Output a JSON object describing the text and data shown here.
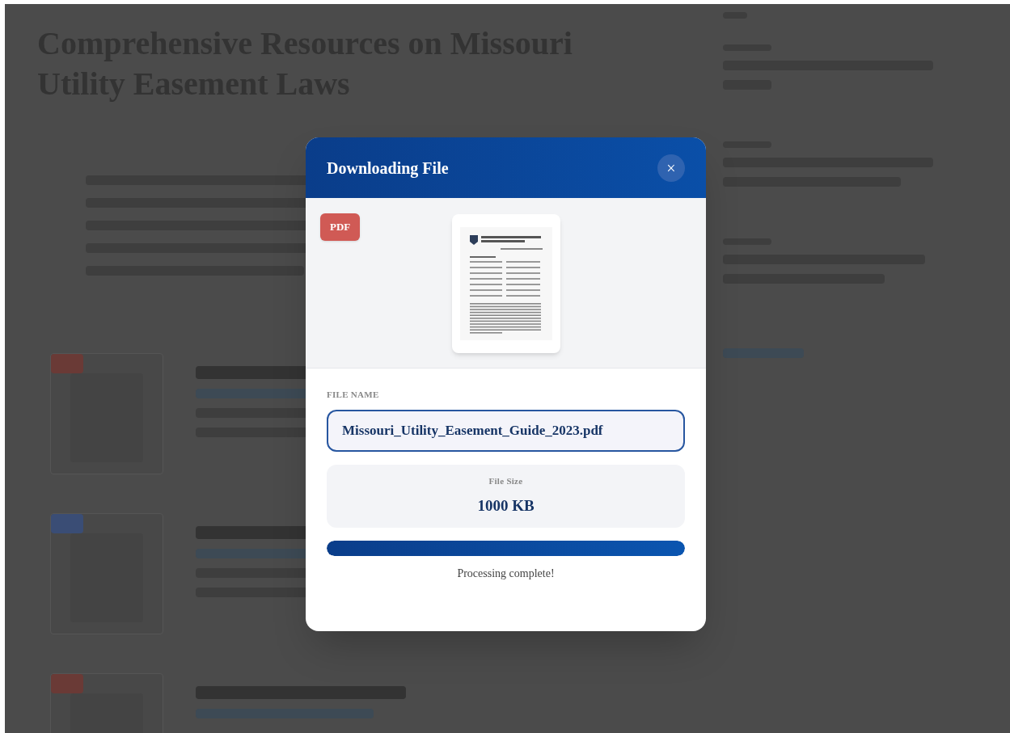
{
  "page": {
    "title": "Comprehensive Resources on Missouri Utility Easement Laws"
  },
  "dialog": {
    "title": "Downloading File",
    "close": "×",
    "badge": "PDF",
    "file_name_label": "FILE NAME",
    "file_name": "Missouri_Utility_Easement_Guide_2023.pdf",
    "size_label": "File Size",
    "size": "1000 KB",
    "progress": {
      "level": 1
    },
    "status": "Processing complete!"
  }
}
